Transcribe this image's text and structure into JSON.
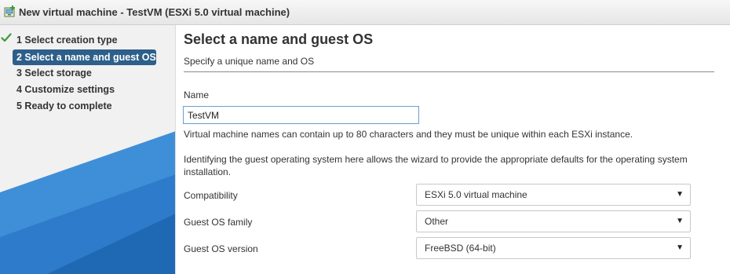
{
  "window": {
    "title": "New virtual machine - TestVM (ESXi 5.0 virtual machine)",
    "icon": "new-vm-icon"
  },
  "nav": {
    "steps": [
      {
        "label": "1  Select creation type",
        "state": "completed"
      },
      {
        "label": "2  Select a name and guest OS",
        "state": "active"
      },
      {
        "label": "3  Select storage",
        "state": "pending"
      },
      {
        "label": "4  Customize settings",
        "state": "pending"
      },
      {
        "label": "5  Ready to complete",
        "state": "pending"
      }
    ],
    "colors": {
      "active": "#2d5f8a",
      "check": "#3c9a3c",
      "graphic_dark": "#1e66b0",
      "graphic_light": "#3f8fd8"
    }
  },
  "main": {
    "title": "Select a name and guest OS",
    "subtitle": "Specify a unique name and OS",
    "name_label": "Name",
    "name_value": "TestVM",
    "name_help": "Virtual machine names can contain up to 80 characters and they must be unique within each ESXi instance.",
    "os_help": "Identifying the guest operating system here allows the wizard to provide the appropriate defaults for the operating system installation.",
    "fields": [
      {
        "label": "Compatibility",
        "value": "ESXi 5.0 virtual machine",
        "icon": "dropdown-arrow-icon"
      },
      {
        "label": "Guest OS family",
        "value": "Other",
        "icon": "dropdown-arrow-icon"
      },
      {
        "label": "Guest OS version",
        "value": "FreeBSD (64-bit)",
        "icon": "dropdown-arrow-icon"
      }
    ]
  }
}
